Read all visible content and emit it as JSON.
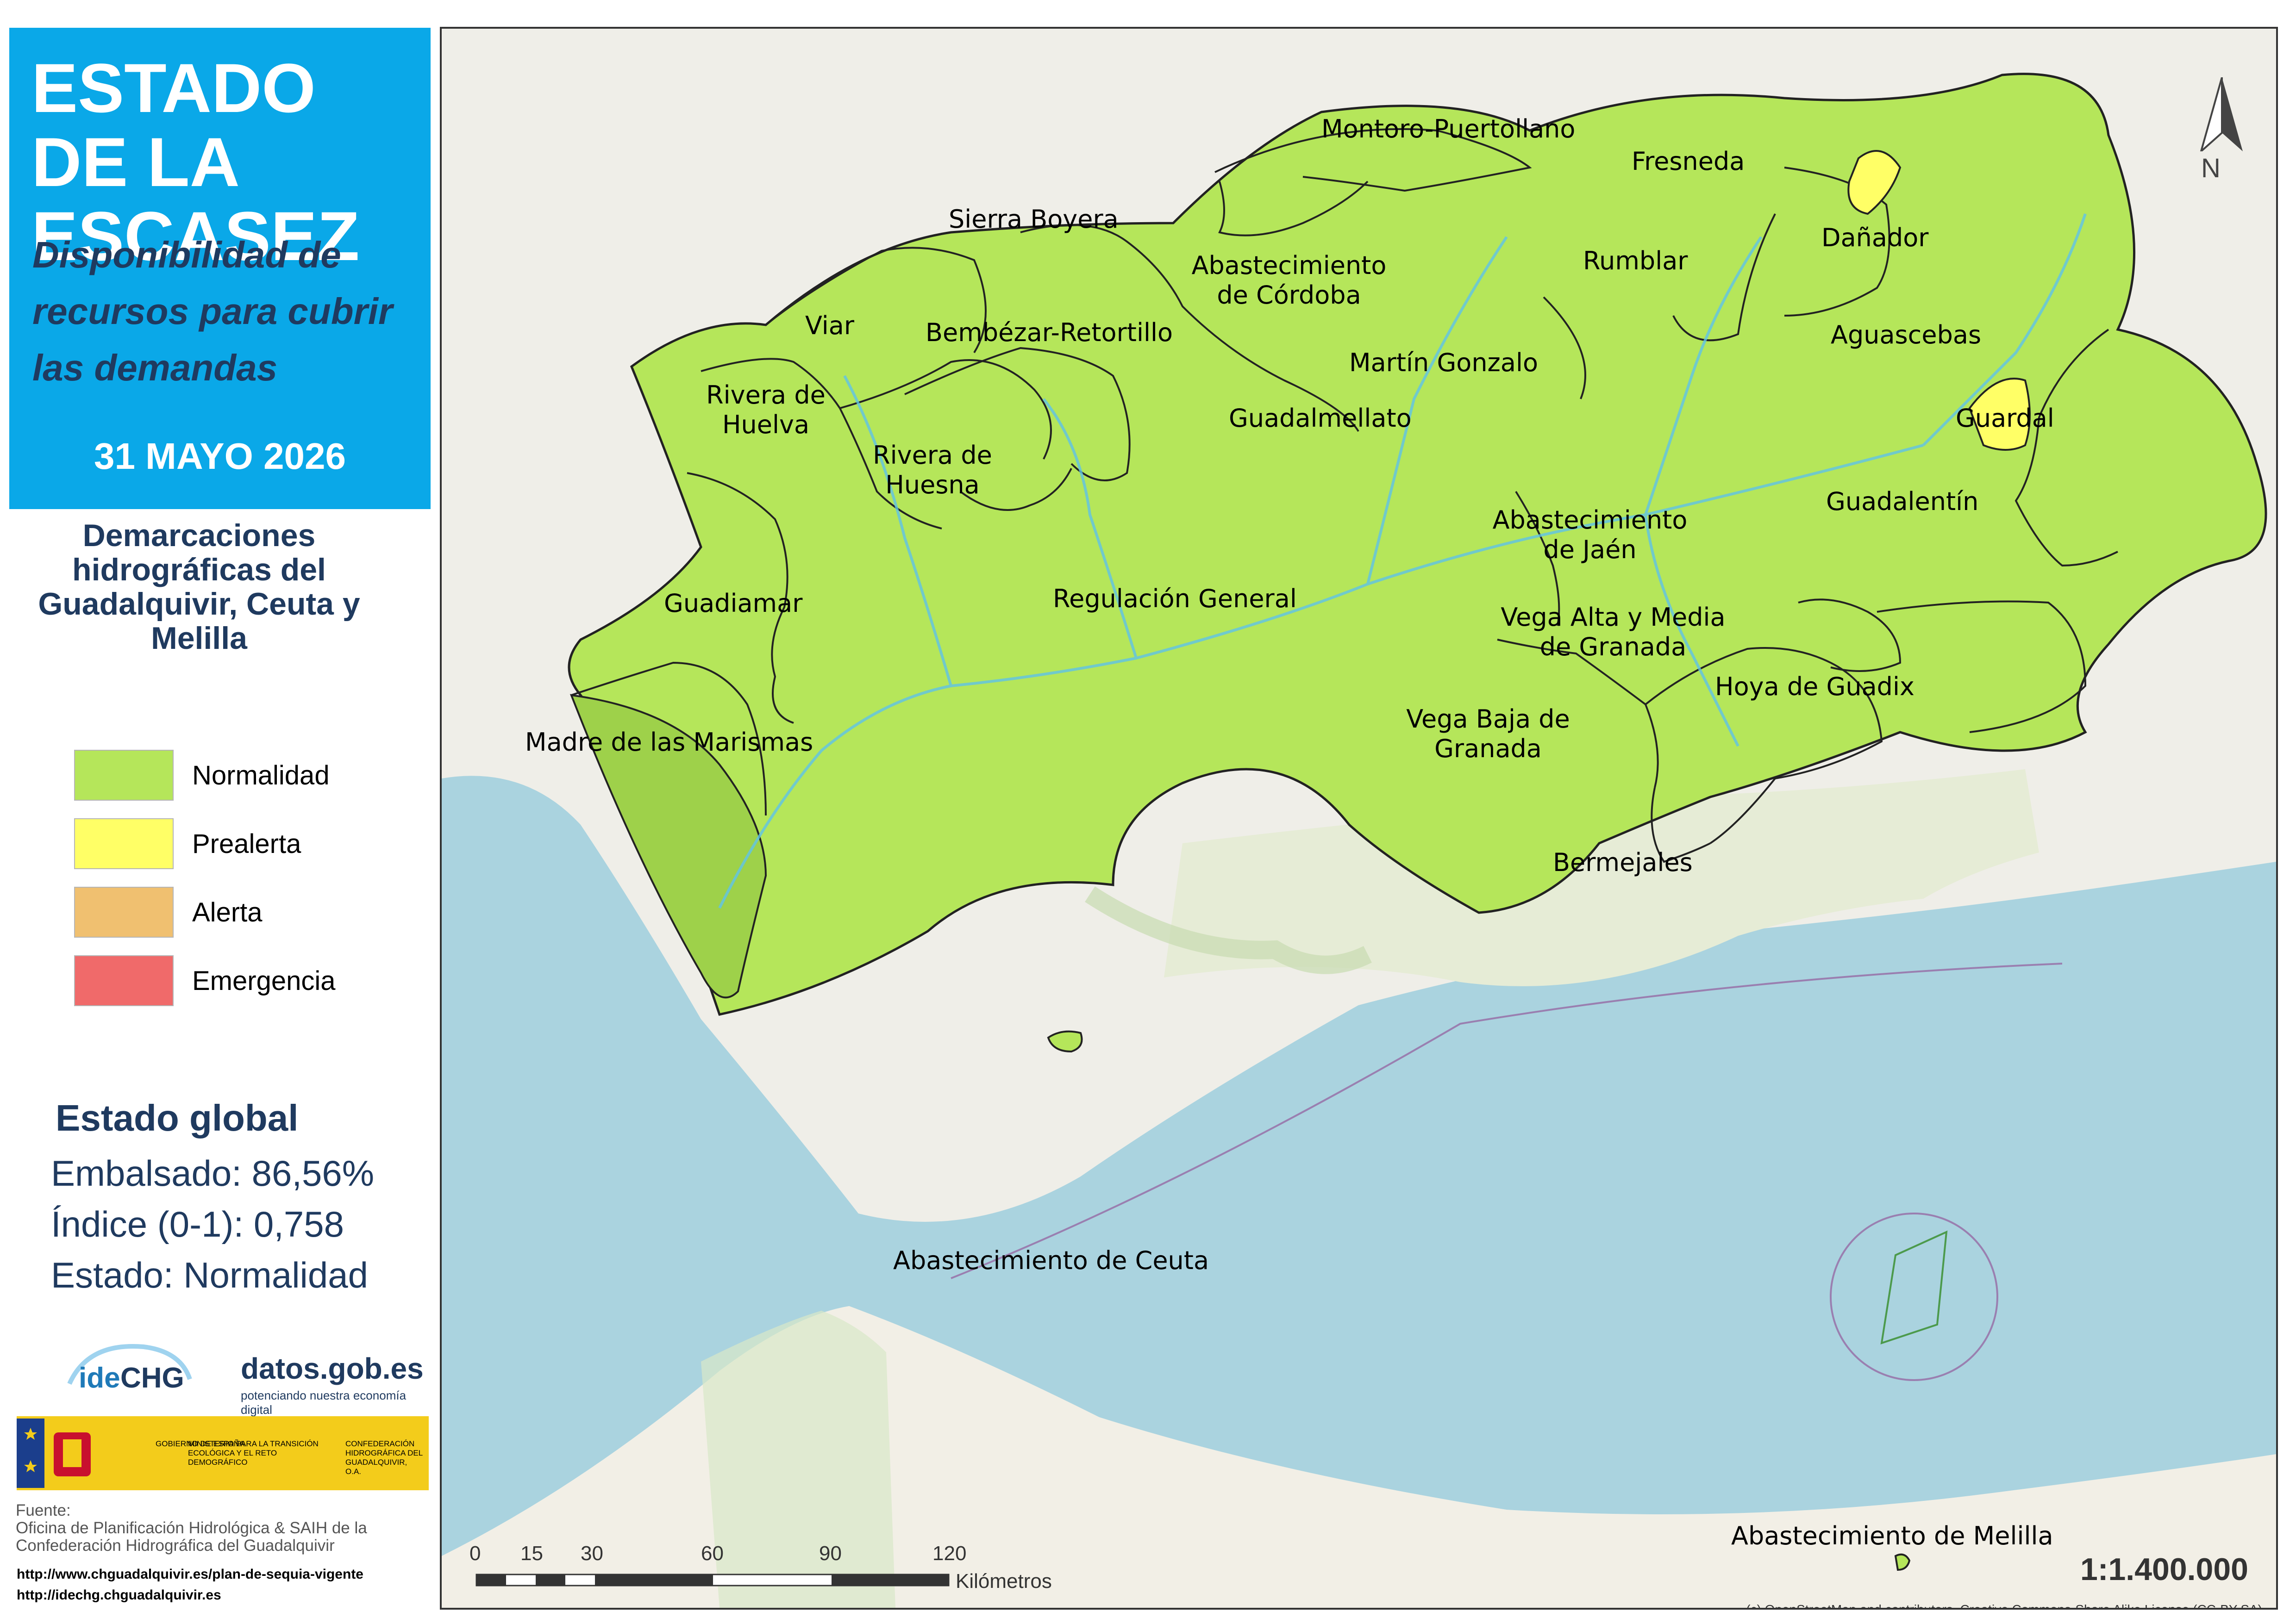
{
  "title": {
    "main": "ESTADO DE LA ESCASEZ",
    "subtitle": "Disponibilidad de recursos para cubrir las demandas",
    "date": "31 MAYO 2026"
  },
  "legend": {
    "heading": "Demarcaciones hidrográficas del Guadalquivir, Ceuta y Melilla",
    "items": [
      {
        "label": "Normalidad",
        "color": "#b5e65a"
      },
      {
        "label": "Prealerta",
        "color": "#ffff66"
      },
      {
        "label": "Alerta",
        "color": "#f0c070"
      },
      {
        "label": "Emergencia",
        "color": "#f06a6a"
      }
    ]
  },
  "global_state": {
    "heading": "Estado global",
    "embalsado": "Embalsado: 86,56%",
    "indice": "Índice (0-1): 0,758",
    "estado": "Estado: Normalidad"
  },
  "logos": {
    "idechg": "ideCHG",
    "datos_main": "datos.gob.es",
    "datos_sub": "potenciando nuestra economía digital",
    "gov_line1": "GOBIERNO DE ESPAÑA",
    "gov_line2": "MINISTERIO PARA LA TRANSICIÓN ECOLÓGICA Y EL RETO DEMOGRÁFICO",
    "gov_line3": "CONFEDERACIÓN HIDROGRÁFICA DEL GUADALQUIVIR, O.A."
  },
  "source": {
    "label": "Fuente:",
    "text": "Oficina de Planificación Hidrológica & SAIH de la Confederación Hidrográfica del Guadalquivir",
    "url1": "http://www.chguadalquivir.es/plan-de-sequia-vigente",
    "url2": "http://idechg.chguadalquivir.es"
  },
  "map": {
    "zones": [
      {
        "name": "Montoro-Puertollano",
        "status": "Normalidad"
      },
      {
        "name": "Fresneda",
        "status": "Normalidad"
      },
      {
        "name": "Sierra Boyera",
        "status": "Normalidad"
      },
      {
        "name": "Dañador",
        "status": "Prealerta"
      },
      {
        "name": "Abastecimiento de Córdoba",
        "status": "Normalidad"
      },
      {
        "name": "Rumblar",
        "status": "Normalidad"
      },
      {
        "name": "Viar",
        "status": "Normalidad"
      },
      {
        "name": "Bembézar-Retortillo",
        "status": "Normalidad"
      },
      {
        "name": "Aguascebas",
        "status": "Normalidad"
      },
      {
        "name": "Martín Gonzalo",
        "status": "Normalidad"
      },
      {
        "name": "Rivera de Huelva",
        "status": "Normalidad"
      },
      {
        "name": "Guardal",
        "status": "Prealerta"
      },
      {
        "name": "Guadalmellato",
        "status": "Normalidad"
      },
      {
        "name": "Rivera de Huesna",
        "status": "Normalidad"
      },
      {
        "name": "Guadalentín",
        "status": "Normalidad"
      },
      {
        "name": "Abastecimiento de Jaén",
        "status": "Normalidad"
      },
      {
        "name": "Guadiamar",
        "status": "Normalidad"
      },
      {
        "name": "Regulación General",
        "status": "Normalidad"
      },
      {
        "name": "Vega Alta y Media de Granada",
        "status": "Normalidad"
      },
      {
        "name": "Hoya de Guadix",
        "status": "Normalidad"
      },
      {
        "name": "Vega Baja de Granada",
        "status": "Normalidad"
      },
      {
        "name": "Madre de las Marismas",
        "status": "Normalidad"
      },
      {
        "name": "Bermejales",
        "status": "Normalidad"
      },
      {
        "name": "Abastecimiento de Ceuta",
        "status": "Normalidad"
      },
      {
        "name": "Abastecimiento de Melilla",
        "status": "Normalidad"
      }
    ],
    "north": "N",
    "scale_ticks": [
      "0",
      "15",
      "30",
      "60",
      "90",
      "120"
    ],
    "scale_unit": "Kilómetros",
    "scale_ratio": "1:1.400.000",
    "attribution": "(c) OpenStreetMap and contributors, Creative Commons-Share Alike License (CC-BY-SA)"
  }
}
